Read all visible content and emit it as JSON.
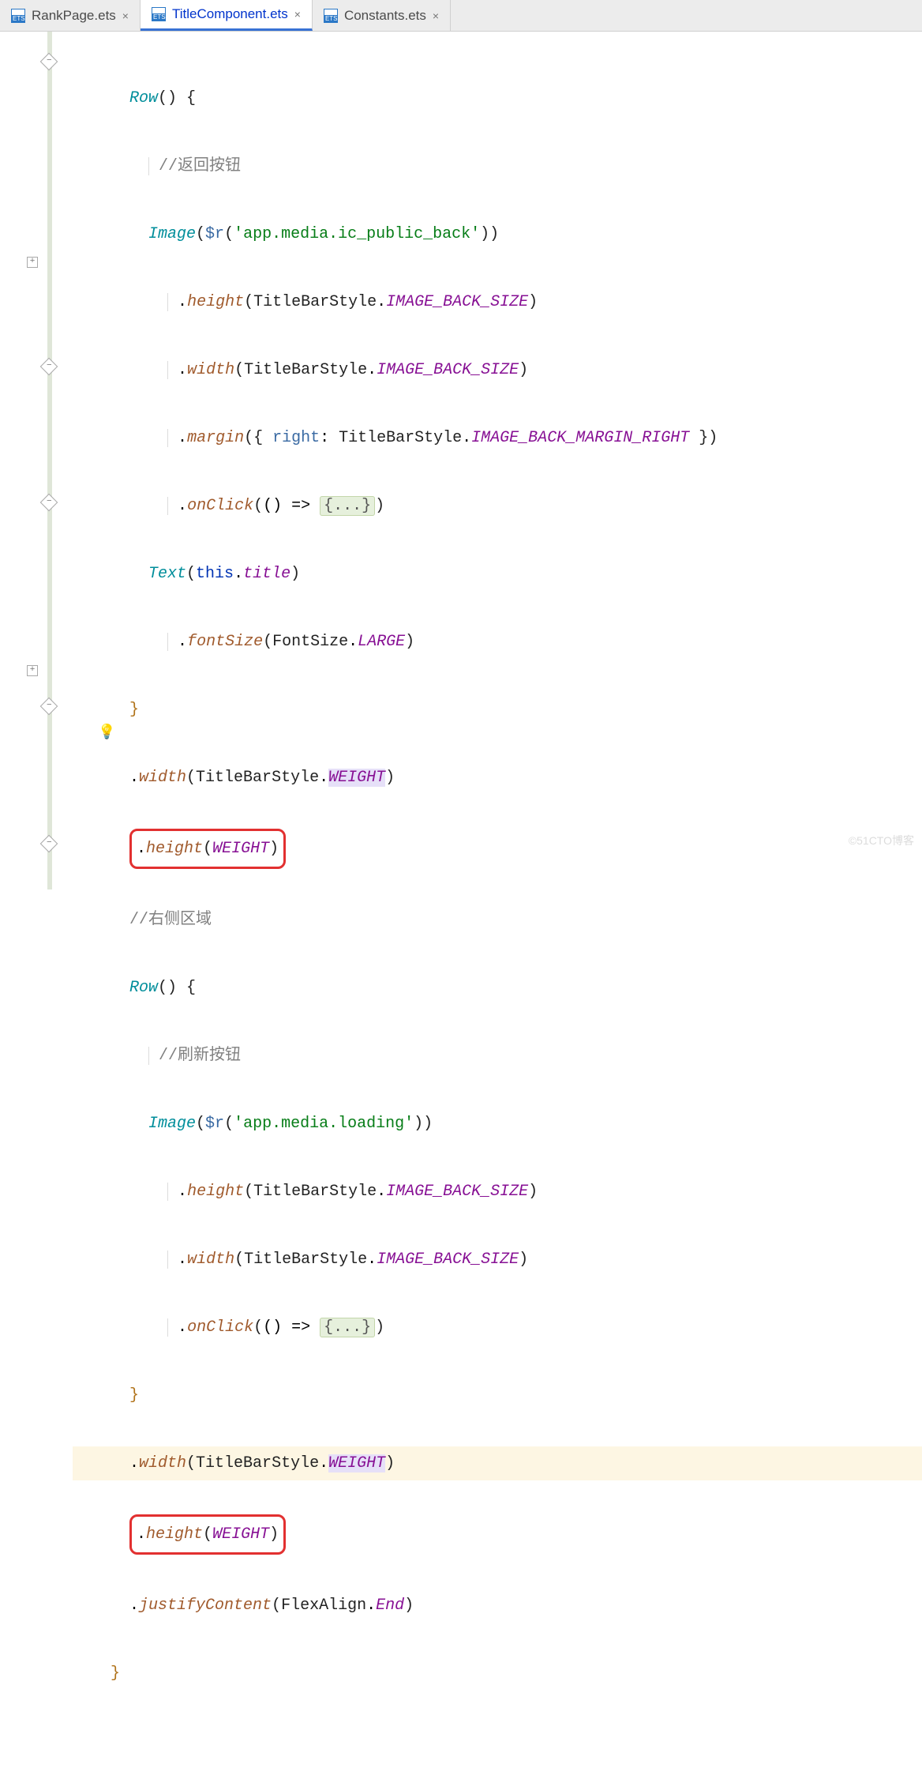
{
  "tabs": [
    {
      "label": "RankPage.ets",
      "active": false
    },
    {
      "label": "TitleComponent.ets",
      "active": true
    },
    {
      "label": "Constants.ets",
      "active": false
    }
  ],
  "code": {
    "row1_open": "Row",
    "brace_open": "{",
    "brace_close": "}",
    "comment_back": "//返回按钮",
    "image": "Image",
    "dollarR": "$r",
    "str_back": "'app.media.ic_public_back'",
    "m_height": "height",
    "m_width": "width",
    "m_margin": "margin",
    "m_onclick": "onClick",
    "m_fontsize": "fontSize",
    "m_justify": "justifyContent",
    "TitleBarStyle": "TitleBarStyle",
    "IMAGE_BACK_SIZE": "IMAGE_BACK_SIZE",
    "IMAGE_BACK_MARGIN_RIGHT": "IMAGE_BACK_MARGIN_RIGHT",
    "right_key": "right",
    "arrow": "() => ",
    "fold_body": "{...}",
    "text": "Text",
    "this": "this",
    "title_prop": "title",
    "FontSize": "FontSize",
    "LARGE": "LARGE",
    "WEIGHT": "WEIGHT",
    "height_weight": ".height(WEIGHT)",
    "comment_right": "//右侧区域",
    "comment_refresh": "//刷新按钮",
    "str_loading": "'app.media.loading'",
    "FlexAlign": "FlexAlign",
    "End": "End"
  },
  "watermark": "©51CTO博客"
}
